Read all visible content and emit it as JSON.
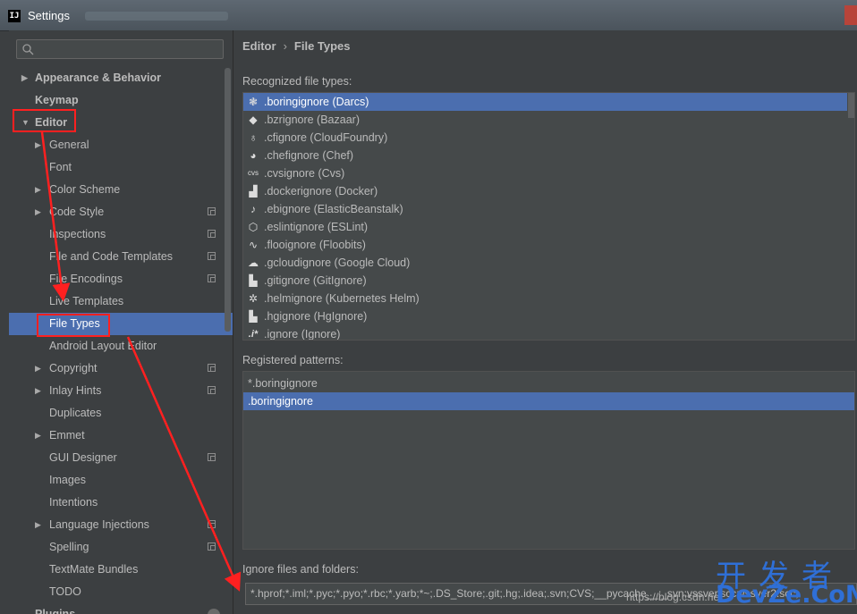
{
  "window": {
    "title": "Settings",
    "app_icon": "IJ"
  },
  "sidebar": {
    "search": {
      "placeholder": ""
    },
    "items": [
      {
        "label": "Appearance & Behavior",
        "expanded": false
      },
      {
        "label": "Keymap"
      },
      {
        "label": "Editor",
        "expanded": true
      },
      {
        "label": "General"
      },
      {
        "label": "Font"
      },
      {
        "label": "Color Scheme"
      },
      {
        "label": "Code Style"
      },
      {
        "label": "Inspections"
      },
      {
        "label": "File and Code Templates"
      },
      {
        "label": "File Encodings"
      },
      {
        "label": "Live Templates"
      },
      {
        "label": "File Types",
        "selected": true
      },
      {
        "label": "Android Layout Editor"
      },
      {
        "label": "Copyright"
      },
      {
        "label": "Inlay Hints"
      },
      {
        "label": "Duplicates"
      },
      {
        "label": "Emmet"
      },
      {
        "label": "GUI Designer"
      },
      {
        "label": "Images"
      },
      {
        "label": "Intentions"
      },
      {
        "label": "Language Injections"
      },
      {
        "label": "Spelling"
      },
      {
        "label": "TextMate Bundles"
      },
      {
        "label": "TODO"
      },
      {
        "label": "Plugins"
      }
    ]
  },
  "main": {
    "breadcrumb": [
      "Editor",
      "File Types"
    ],
    "breadcrumb_sep": "›",
    "recognized_label": "Recognized file types:",
    "file_types": [
      {
        "name": ".boringignore (Darcs)",
        "icon": "darcs-icon",
        "selected": true
      },
      {
        "name": ".bzrignore (Bazaar)",
        "icon": "bazaar-icon"
      },
      {
        "name": ".cfignore (CloudFoundry)",
        "icon": "cloudfoundry-icon"
      },
      {
        "name": ".chefignore (Chef)",
        "icon": "chef-icon"
      },
      {
        "name": ".cvsignore (Cvs)",
        "icon": "cvs-icon"
      },
      {
        "name": ".dockerignore (Docker)",
        "icon": "docker-icon"
      },
      {
        "name": ".ebignore (ElasticBeanstalk)",
        "icon": "elasticbeanstalk-icon"
      },
      {
        "name": ".eslintignore (ESLint)",
        "icon": "eslint-icon"
      },
      {
        "name": ".flooignore (Floobits)",
        "icon": "floobits-icon"
      },
      {
        "name": ".gcloudignore (Google Cloud)",
        "icon": "google-cloud-icon"
      },
      {
        "name": ".gitignore (GitIgnore)",
        "icon": "git-icon"
      },
      {
        "name": ".helmignore (Kubernetes Helm)",
        "icon": "helm-icon"
      },
      {
        "name": ".hgignore (HgIgnore)",
        "icon": "mercurial-icon"
      },
      {
        "name": ".ignore (Ignore)",
        "icon": "ignore-icon"
      }
    ],
    "patterns_label": "Registered patterns:",
    "patterns": [
      {
        "value": "*.boringignore"
      },
      {
        "value": ".boringignore",
        "selected": true
      }
    ],
    "ignore_label": "Ignore files and folders:",
    "ignore_value": "*.hprof;*.iml;*.pyc;*.pyo;*.rbc;*.yarb;*~;.DS_Store;.git;.hg;.idea;.svn;CVS;__pycache__;_svn;vssver.scc;vssver2.scc;"
  },
  "watermark": {
    "cn": "开发者",
    "en": "DevZe.CoM",
    "url": "https://blog.csdn.net"
  },
  "colors": {
    "selection": "#4b6eaf",
    "annotation": "#ff2020",
    "background": "#3c3f41"
  }
}
